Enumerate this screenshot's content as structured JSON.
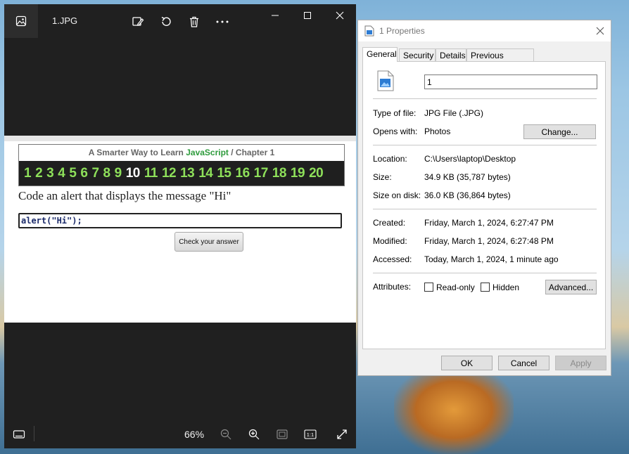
{
  "photos": {
    "title": "1.JPG",
    "image": {
      "chapter_prefix": "A Smarter Way to Learn",
      "chapter_js": "JavaScript",
      "chapter_suffix": "/  Chapter 1",
      "numbers": [
        "1",
        "2",
        "3",
        "4",
        "5",
        "6",
        "7",
        "8",
        "9",
        "10",
        "11",
        "12",
        "13",
        "14",
        "15",
        "16",
        "17",
        "18",
        "19",
        "20"
      ],
      "current_number": "10",
      "question": "Code an alert that displays the message \"Hi\"",
      "answer": "alert(\"Hi\");",
      "check_button": "Check your answer"
    },
    "zoom": "66%"
  },
  "properties": {
    "title": "1 Properties",
    "tabs": [
      "General",
      "Security",
      "Details",
      "Previous Versions"
    ],
    "filename": "1",
    "type_label": "Type of file:",
    "type_value": "JPG File (.JPG)",
    "opens_label": "Opens with:",
    "opens_value": "Photos",
    "change_button": "Change...",
    "location_label": "Location:",
    "location_value": "C:\\Users\\laptop\\Desktop",
    "size_label": "Size:",
    "size_value": "34.9 KB (35,787 bytes)",
    "disk_label": "Size on disk:",
    "disk_value": "36.0 KB (36,864 bytes)",
    "created_label": "Created:",
    "created_value": "Friday, March 1, 2024, 6:27:47 PM",
    "modified_label": "Modified:",
    "modified_value": "Friday, March 1, 2024, 6:27:48 PM",
    "accessed_label": "Accessed:",
    "accessed_value": "Today, March 1, 2024, 1 minute ago",
    "attributes_label": "Attributes:",
    "readonly_label": "Read-only",
    "hidden_label": "Hidden",
    "advanced_button": "Advanced...",
    "ok_button": "OK",
    "cancel_button": "Cancel",
    "apply_button": "Apply"
  }
}
